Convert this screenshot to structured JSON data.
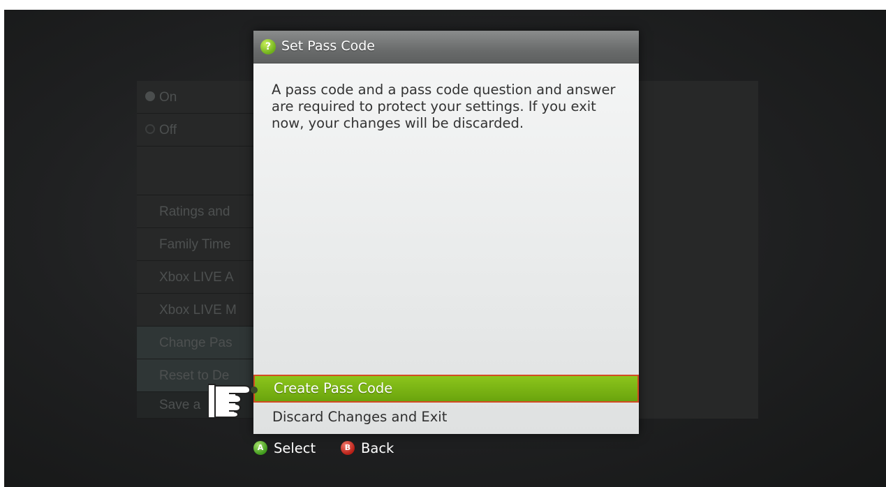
{
  "background_menu": {
    "items": [
      {
        "label": "On",
        "radio": "filled"
      },
      {
        "label": "Off",
        "radio": "empty"
      },
      {
        "label": "",
        "radio": "none"
      },
      {
        "label": "Ratings and",
        "radio": "none"
      },
      {
        "label": "Family Time",
        "radio": "none"
      },
      {
        "label": "Xbox LIVE A",
        "radio": "none"
      },
      {
        "label": "Xbox LIVE M",
        "radio": "none"
      },
      {
        "label": "Change Pas",
        "radio": "none"
      },
      {
        "label": "Reset to De",
        "radio": "none"
      },
      {
        "label": "Save a",
        "radio": "none"
      }
    ]
  },
  "dialog": {
    "title": "Set Pass Code",
    "help_icon": "?",
    "message": "A pass code and a pass code question and answer are required to protect your settings. If you exit now, your changes will be discarded.",
    "options": [
      {
        "label": "Create Pass Code",
        "selected": true
      },
      {
        "label": "Discard Changes and Exit",
        "selected": false
      }
    ]
  },
  "hints": {
    "select_button": "A",
    "select_label": "Select",
    "back_button": "B",
    "back_label": "Back"
  },
  "colors": {
    "accent_green": "#7ab515",
    "selection_border": "#d24c22",
    "dialog_body": "#ececec"
  },
  "icons": {
    "help": "help-icon",
    "pointer": "pointing-hand-icon"
  }
}
